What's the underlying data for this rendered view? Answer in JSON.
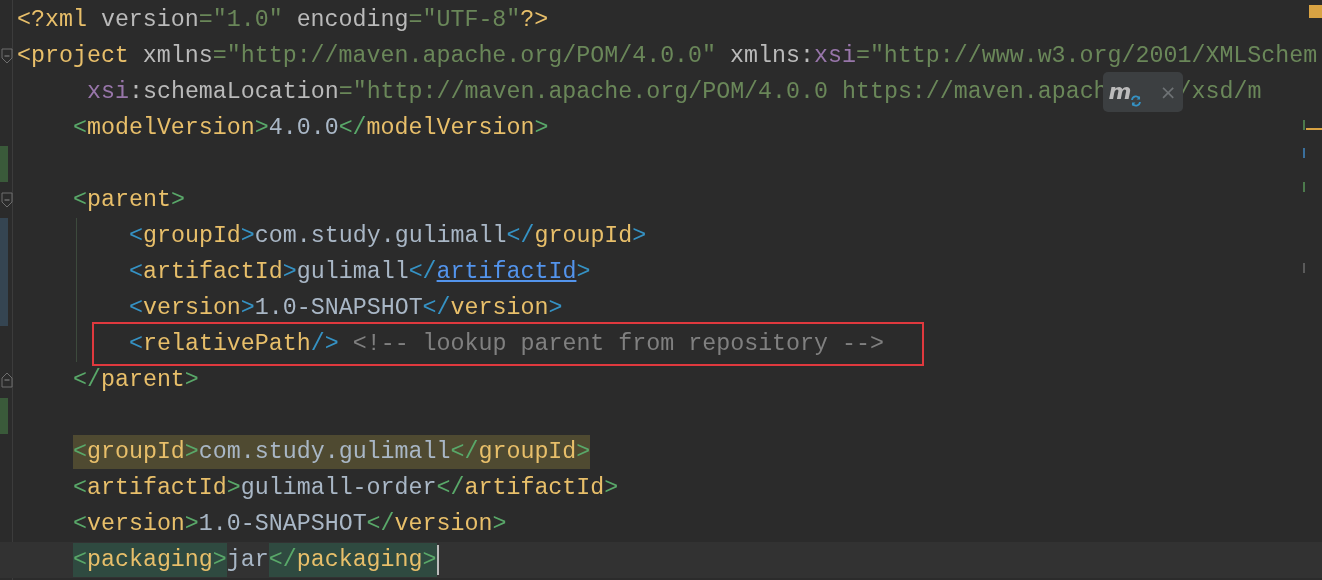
{
  "editor": {
    "lines": [
      {
        "kind": "code",
        "tokens": [
          {
            "kind": "bracket",
            "text": "<?"
          },
          {
            "kind": "tag",
            "text": "xml"
          },
          {
            "kind": "attr",
            "text": " version"
          },
          {
            "kind": "eq",
            "text": "="
          },
          {
            "kind": "string",
            "text": "\"1.0\""
          },
          {
            "kind": "attr",
            "text": " encoding"
          },
          {
            "kind": "eq",
            "text": "="
          },
          {
            "kind": "string",
            "text": "\"UTF-8\""
          },
          {
            "kind": "bracket",
            "text": "?>"
          }
        ]
      },
      {
        "kind": "code",
        "fold_start": true,
        "tokens": [
          {
            "kind": "bracket",
            "text": "<"
          },
          {
            "kind": "tag",
            "text": "project"
          },
          {
            "kind": "attr",
            "text": " xmlns"
          },
          {
            "kind": "eq",
            "text": "="
          },
          {
            "kind": "string",
            "text": "\"http://maven.apache.org/POM/4.0.0\""
          },
          {
            "kind": "attr",
            "text": " xmlns"
          },
          {
            "kind": "colon",
            "text": ":"
          },
          {
            "kind": "ns",
            "text": "xsi"
          },
          {
            "kind": "eq",
            "text": "="
          },
          {
            "kind": "string",
            "text": "\"http://www.w3.org/2001/XMLSchem"
          }
        ],
        "children": [
          {
            "kind": "continuation",
            "tokens": [
              {
                "kind": "ns",
                "text": "xsi"
              },
              {
                "kind": "colon",
                "text": ":"
              },
              {
                "kind": "attr",
                "text": "schemaLocation"
              },
              {
                "kind": "eq",
                "text": "="
              },
              {
                "kind": "string",
                "text": "\"http://maven.apache.org/POM/4.0.0 https://maven.apach"
              },
              {
                "kind": "popup",
                "logo": "m",
                "close": "×"
              },
              {
                "kind": "string",
                "text": "/xsd/m"
              }
            ]
          },
          {
            "kind": "code",
            "tokens": [
              {
                "kind": "bracket",
                "text": "<"
              },
              {
                "kind": "tag",
                "text": "modelVersion"
              },
              {
                "kind": "bracket",
                "text": ">"
              },
              {
                "kind": "text",
                "text": "4.0.0"
              },
              {
                "kind": "bracket",
                "text": "</"
              },
              {
                "kind": "tag",
                "text": "modelVersion"
              },
              {
                "kind": "bracket",
                "text": ">"
              }
            ]
          },
          {
            "kind": "blank",
            "added": true
          },
          {
            "kind": "code",
            "fold_start": true,
            "tokens": [
              {
                "kind": "bracket",
                "text": "<"
              },
              {
                "kind": "tag",
                "text": "parent"
              },
              {
                "kind": "bracket",
                "text": ">"
              }
            ],
            "children": [
              {
                "kind": "code",
                "modified": true,
                "tokens": [
                  {
                    "kind": "bracket",
                    "text": "<"
                  },
                  {
                    "kind": "tag",
                    "text": "groupId"
                  },
                  {
                    "kind": "bracket",
                    "text": ">"
                  },
                  {
                    "kind": "text",
                    "text": "com.study.gulimall"
                  },
                  {
                    "kind": "bracket",
                    "text": "</"
                  },
                  {
                    "kind": "tag",
                    "text": "groupId"
                  },
                  {
                    "kind": "bracket",
                    "text": ">"
                  }
                ]
              },
              {
                "kind": "code",
                "modified": true,
                "tokens": [
                  {
                    "kind": "bracket",
                    "text": "<"
                  },
                  {
                    "kind": "tag",
                    "text": "artifactId"
                  },
                  {
                    "kind": "bracket",
                    "text": ">"
                  },
                  {
                    "kind": "text",
                    "text": "gulimall"
                  },
                  {
                    "kind": "bracket",
                    "text": "</"
                  },
                  {
                    "kind": "link",
                    "text": "artifactId"
                  },
                  {
                    "kind": "bracket",
                    "text": ">"
                  }
                ]
              },
              {
                "kind": "code",
                "modified": true,
                "tokens": [
                  {
                    "kind": "bracket",
                    "text": "<"
                  },
                  {
                    "kind": "tag",
                    "text": "version"
                  },
                  {
                    "kind": "bracket",
                    "text": ">"
                  },
                  {
                    "kind": "text",
                    "text": "1.0-SNAPSHOT"
                  },
                  {
                    "kind": "bracket",
                    "text": "</"
                  },
                  {
                    "kind": "tag",
                    "text": "version"
                  },
                  {
                    "kind": "bracket",
                    "text": ">"
                  }
                ]
              },
              {
                "kind": "code",
                "boxed": true,
                "tokens": [
                  {
                    "kind": "bracket",
                    "text": "<"
                  },
                  {
                    "kind": "tag",
                    "text": "relativePath"
                  },
                  {
                    "kind": "bracket",
                    "text": "/>"
                  },
                  {
                    "kind": "comment",
                    "text": " <!-- lookup parent from repository -->"
                  }
                ]
              }
            ]
          },
          {
            "kind": "code",
            "fold_end": true,
            "tokens": [
              {
                "kind": "bracket",
                "text": "</"
              },
              {
                "kind": "tag",
                "text": "parent"
              },
              {
                "kind": "bracket",
                "text": ">"
              }
            ]
          },
          {
            "kind": "blank",
            "added": true
          },
          {
            "kind": "code",
            "tokens": [
              {
                "kind": "bracket",
                "text": "<",
                "usage_highlight": true
              },
              {
                "kind": "tag",
                "text": "groupId",
                "usage_highlight": true
              },
              {
                "kind": "bracket",
                "text": ">",
                "usage_highlight": true
              },
              {
                "kind": "text",
                "text": "com.study.gulimall",
                "usage_highlight": true
              },
              {
                "kind": "bracket",
                "text": "</",
                "usage_highlight": true
              },
              {
                "kind": "tag",
                "text": "groupId",
                "usage_highlight": true
              },
              {
                "kind": "bracket",
                "text": ">",
                "usage_highlight": true
              }
            ]
          },
          {
            "kind": "code",
            "tokens": [
              {
                "kind": "bracket",
                "text": "<"
              },
              {
                "kind": "tag",
                "text": "artifactId"
              },
              {
                "kind": "bracket",
                "text": ">"
              },
              {
                "kind": "text",
                "text": "gulimall-order"
              },
              {
                "kind": "bracket",
                "text": "</"
              },
              {
                "kind": "tag",
                "text": "artifactId"
              },
              {
                "kind": "bracket",
                "text": ">"
              }
            ]
          },
          {
            "kind": "code",
            "tokens": [
              {
                "kind": "bracket",
                "text": "<"
              },
              {
                "kind": "tag",
                "text": "version"
              },
              {
                "kind": "bracket",
                "text": ">"
              },
              {
                "kind": "text",
                "text": "1.0-SNAPSHOT"
              },
              {
                "kind": "bracket",
                "text": "</"
              },
              {
                "kind": "tag",
                "text": "version"
              },
              {
                "kind": "bracket",
                "text": ">"
              }
            ]
          },
          {
            "kind": "code",
            "current": true,
            "tokens": [
              {
                "kind": "bracket",
                "text": "<",
                "brace_highlight": true
              },
              {
                "kind": "tag",
                "text": "packaging",
                "brace_highlight": true
              },
              {
                "kind": "bracket",
                "text": ">",
                "brace_highlight": true
              },
              {
                "kind": "text",
                "text": "jar"
              },
              {
                "kind": "bracket",
                "text": "</",
                "brace_highlight": true
              },
              {
                "kind": "tag",
                "text": "packaging",
                "brace_highlight": true
              },
              {
                "kind": "bracket",
                "text": ">",
                "brace_highlight": true
              }
            ]
          }
        ]
      }
    ]
  }
}
